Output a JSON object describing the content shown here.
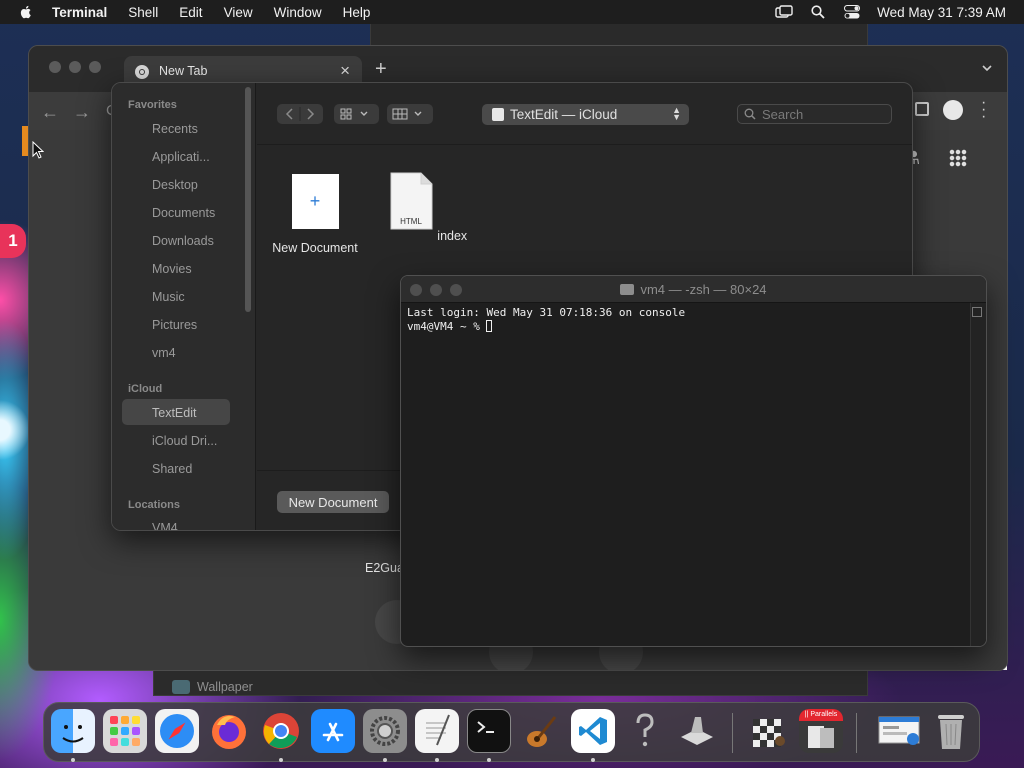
{
  "menubar": {
    "app_name": "Terminal",
    "items": [
      "Shell",
      "Edit",
      "View",
      "Window",
      "Help"
    ],
    "clock": "Wed May 31  7:39 AM"
  },
  "chrome": {
    "tab_title": "New Tab",
    "close_glyph": "×",
    "new_tab_glyph": "+",
    "back_glyph": "←",
    "forward_glyph": "→",
    "reload_glyph": "C",
    "lab_glyph": "⚗",
    "page_label": "E2Gua"
  },
  "finder": {
    "favorites_header": "Favorites",
    "favorites": [
      "Recents",
      "Applicati...",
      "Desktop",
      "Documents",
      "Downloads",
      "Movies",
      "Music",
      "Pictures",
      "vm4"
    ],
    "icloud_header": "iCloud",
    "icloud": [
      "TextEdit",
      "iCloud Dri...",
      "Shared"
    ],
    "locations_header": "Locations",
    "locations": [
      "VM4"
    ],
    "location_popup": "TextEdit — iCloud",
    "search_placeholder": "Search",
    "files": [
      {
        "name": "New Document",
        "kind": "new-document"
      },
      {
        "name": "index",
        "kind": "html",
        "badge": "HTML"
      }
    ],
    "new_document_button": "New Document"
  },
  "terminal": {
    "title": "vm4 — -zsh — 80×24",
    "lines": [
      "Last login: Wed May 31 07:18:36 on console",
      "vm4@VM4 ~ % "
    ]
  },
  "background": {
    "wallpaper_window_label": "Wallpaper",
    "badge_count": "1"
  },
  "dock": {
    "apps": [
      "Finder",
      "Launchpad",
      "Safari",
      "Firefox",
      "Google Chrome",
      "App Store",
      "System Settings",
      "TextEdit",
      "Terminal",
      "GarageBand",
      "Visual Studio Code",
      "Help",
      "Xcode Utility",
      "Chess",
      "Parallels",
      "Preview",
      "Trash"
    ],
    "parallels_label": "|| Parallels"
  }
}
